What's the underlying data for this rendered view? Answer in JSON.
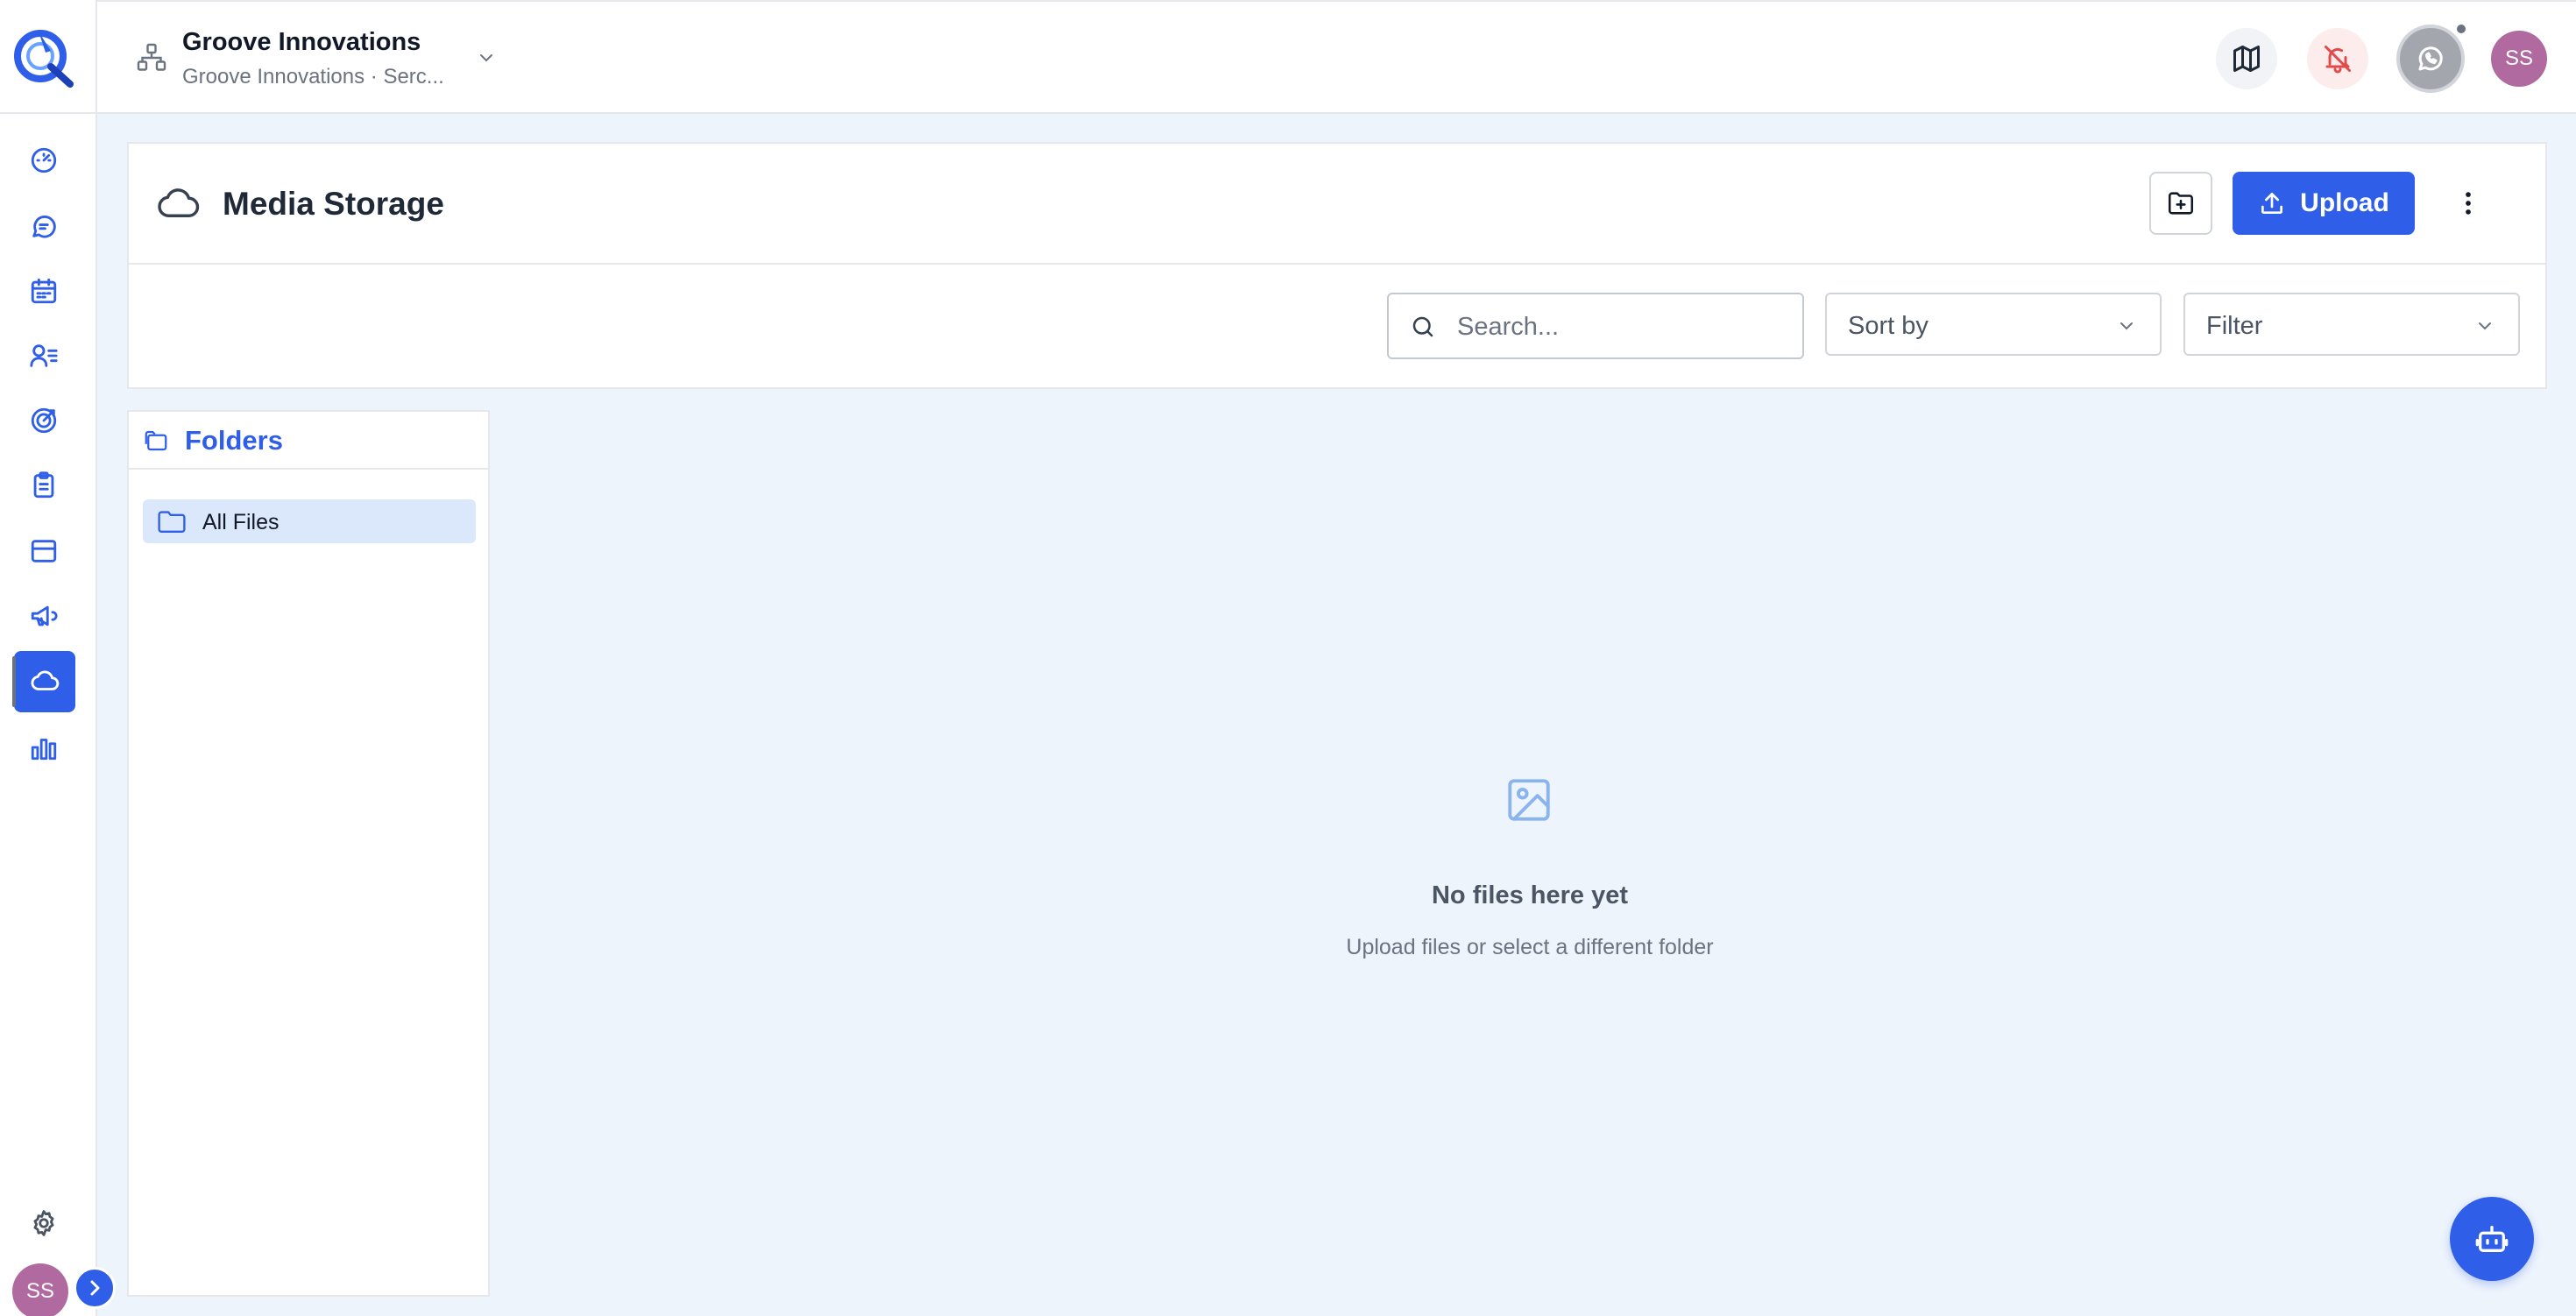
{
  "org": {
    "name": "Groove Innovations",
    "subtitle": "Groove Innovations · Serc..."
  },
  "user": {
    "initials": "SS"
  },
  "sidebar": {
    "items": [
      {
        "name": "dashboard",
        "icon": "gauge-icon"
      },
      {
        "name": "chats",
        "icon": "message-icon"
      },
      {
        "name": "calendar",
        "icon": "calendar-icon"
      },
      {
        "name": "contacts",
        "icon": "user-list-icon"
      },
      {
        "name": "targets",
        "icon": "target-icon"
      },
      {
        "name": "tasks",
        "icon": "clipboard-icon"
      },
      {
        "name": "inbox",
        "icon": "inbox-icon"
      },
      {
        "name": "campaigns",
        "icon": "megaphone-icon"
      },
      {
        "name": "media-storage",
        "icon": "cloud-icon",
        "active": true
      },
      {
        "name": "analytics",
        "icon": "bar-chart-icon"
      }
    ]
  },
  "page": {
    "title": "Media Storage",
    "upload_label": "Upload"
  },
  "toolbar": {
    "search_placeholder": "Search...",
    "sort_label": "Sort by",
    "filter_label": "Filter"
  },
  "folders": {
    "title": "Folders",
    "items": [
      {
        "label": "All Files",
        "selected": true
      }
    ]
  },
  "empty_state": {
    "title": "No files here yet",
    "subtitle": "Upload files or select a different folder"
  },
  "colors": {
    "accent": "#2f5fe8",
    "avatar": "#b06aa0",
    "background": "#eef4fc",
    "selected_folder": "#dbe8fb",
    "alert": "#e24b4b"
  }
}
